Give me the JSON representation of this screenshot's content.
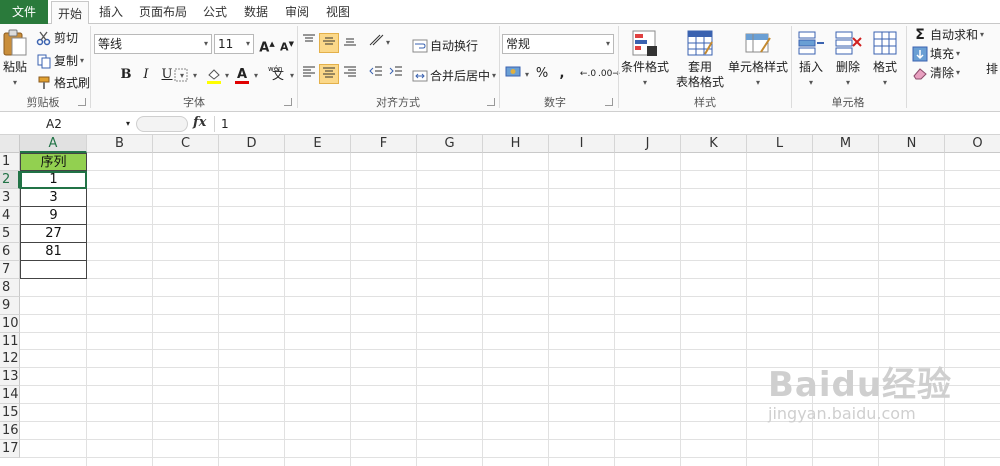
{
  "tabs": {
    "file": "文件",
    "home": "开始",
    "insert": "插入",
    "page_layout": "页面布局",
    "formulas": "公式",
    "data": "数据",
    "review": "审阅",
    "view": "视图"
  },
  "clipboard": {
    "paste": "粘贴",
    "cut": "剪切",
    "copy": "复制",
    "format_painter": "格式刷",
    "group": "剪贴板"
  },
  "font": {
    "name": "等线",
    "size": "11",
    "bold": "B",
    "italic": "I",
    "underline": "U",
    "font_color_letter": "A",
    "wen": "wén",
    "group": "字体"
  },
  "alignment": {
    "wrap_text": "自动换行",
    "merge_center": "合并后居中",
    "group": "对齐方式"
  },
  "number": {
    "format": "常规",
    "percent": "%",
    "comma": ",",
    "group": "数字"
  },
  "styles": {
    "conditional": "条件格式",
    "table_line1": "套用",
    "table_line2": "表格格式",
    "cell_styles": "单元格样式",
    "group": "样式"
  },
  "cells": {
    "insert": "插入",
    "delete": "删除",
    "format": "格式",
    "group": "单元格"
  },
  "editing": {
    "autosum": "自动求和",
    "fill": "填充",
    "clear": "清除",
    "sort_partial": "排"
  },
  "formula_bar": {
    "name_box": "A2",
    "fx": "fx",
    "value": "1"
  },
  "sheet": {
    "columns": [
      "A",
      "B",
      "C",
      "D",
      "E",
      "F",
      "G",
      "H",
      "I",
      "J",
      "K",
      "L",
      "M",
      "N",
      "O"
    ],
    "rows": [
      "1",
      "2",
      "3",
      "4",
      "5",
      "6",
      "7",
      "8",
      "9",
      "10",
      "11",
      "12",
      "13",
      "14",
      "15",
      "16",
      "17"
    ],
    "column_a": [
      "序列",
      "1",
      "3",
      "9",
      "27",
      "81",
      ""
    ],
    "header_fill": "#92d050",
    "selection_color": "#217346"
  },
  "watermark": {
    "main": "Baidu经验",
    "sub": "jingyan.baidu.com"
  }
}
